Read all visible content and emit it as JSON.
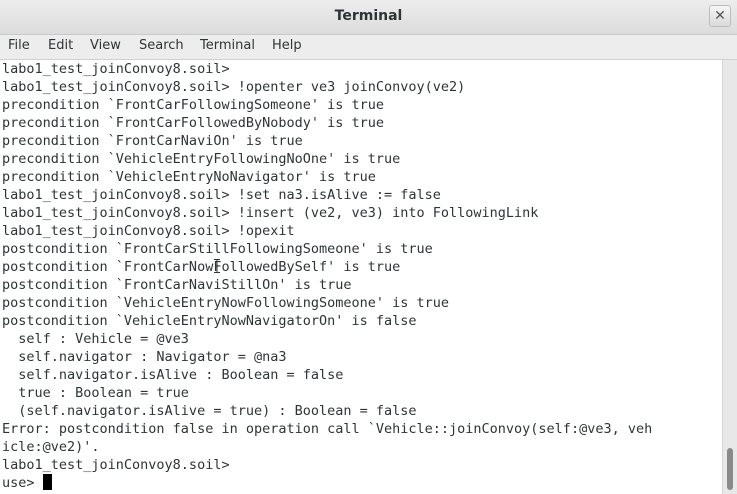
{
  "window": {
    "title": "Terminal",
    "close_glyph": "✕"
  },
  "menubar": {
    "items": [
      "File",
      "Edit",
      "View",
      "Search",
      "Terminal",
      "Help"
    ]
  },
  "terminal": {
    "lines": [
      "labo1_test_joinConvoy8.soil>",
      "labo1_test_joinConvoy8.soil> !openter ve3 joinConvoy(ve2)",
      "precondition `FrontCarFollowingSomeone' is true",
      "precondition `FrontCarFollowedByNobody' is true",
      "precondition `FrontCarNaviOn' is true",
      "precondition `VehicleEntryFollowingNoOne' is true",
      "precondition `VehicleEntryNoNavigator' is true",
      "labo1_test_joinConvoy8.soil> !set na3.isAlive := false",
      "labo1_test_joinConvoy8.soil> !insert (ve2, ve3) into FollowingLink",
      "labo1_test_joinConvoy8.soil> !opexit",
      "postcondition `FrontCarStillFollowingSomeone' is true",
      "postcondition `FrontCarNowFollowedBySelf' is true",
      "postcondition `FrontCarNaviStillOn' is true",
      "postcondition `VehicleEntryNowFollowingSomeone' is true",
      "postcondition `VehicleEntryNowNavigatorOn' is false",
      "  self : Vehicle = @ve3",
      "  self.navigator : Navigator = @na3",
      "  self.navigator.isAlive : Boolean = false",
      "  true : Boolean = true",
      "  (self.navigator.isAlive = true) : Boolean = false",
      "Error: postcondition false in operation call `Vehicle::joinConvoy(self:@ve3, veh",
      "icle:@ve2)'.",
      "labo1_test_joinConvoy8.soil>",
      "use> "
    ]
  }
}
